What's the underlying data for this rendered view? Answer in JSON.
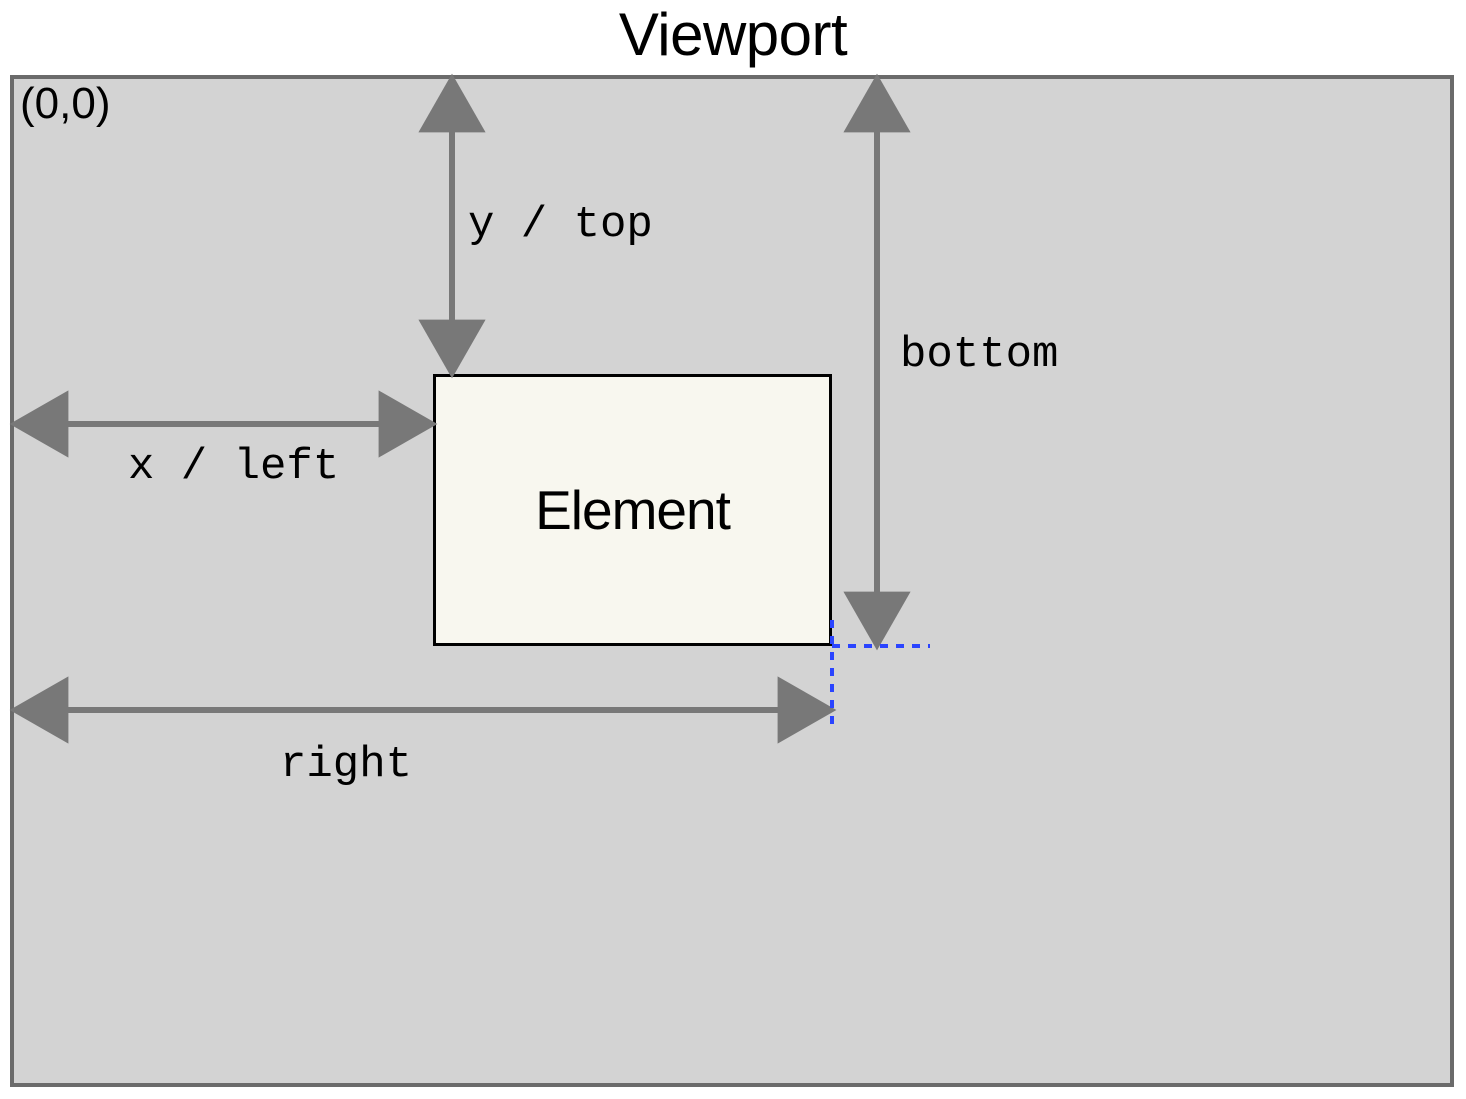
{
  "title": "Viewport",
  "origin_label": "(0,0)",
  "element_label": "Element",
  "dimensions": {
    "y_top": "y / top",
    "x_left": "x / left",
    "bottom": "bottom",
    "right": "right"
  },
  "colors": {
    "viewport_bg": "#d3d3d3",
    "viewport_border": "#6b6b6b",
    "element_bg": "#f8f7ef",
    "arrow": "#787878",
    "guide_line": "#2a44ff"
  }
}
